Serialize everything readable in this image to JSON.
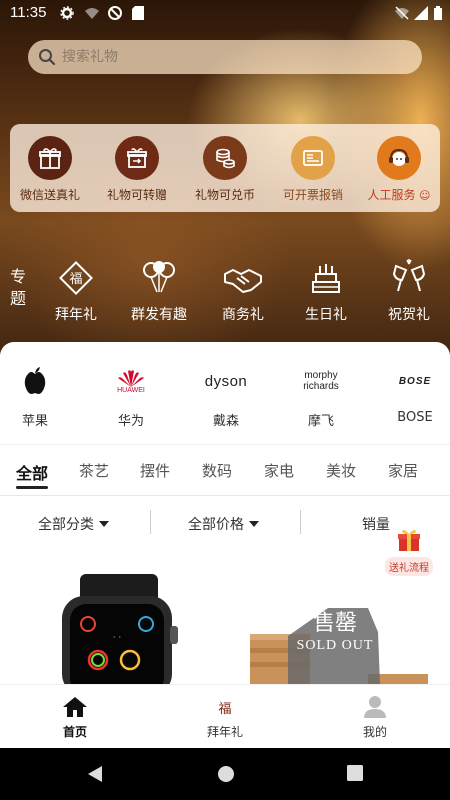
{
  "status_bar": {
    "time": "11:35"
  },
  "search": {
    "placeholder": "搜索礼物"
  },
  "services": [
    {
      "label": "微信送真礼",
      "icon": "gift-box-icon"
    },
    {
      "label": "礼物可转赠",
      "icon": "gift-transfer-icon"
    },
    {
      "label": "礼物可兑币",
      "icon": "coin-stack-icon"
    },
    {
      "label": "可开票报销",
      "icon": "invoice-icon"
    },
    {
      "label": "人工服务",
      "icon": "customer-service-icon"
    }
  ],
  "topics": {
    "title": "专题",
    "items": [
      {
        "label": "拜年礼",
        "icon": "fu-diamond-icon"
      },
      {
        "label": "群发有趣",
        "icon": "balloons-icon"
      },
      {
        "label": "商务礼",
        "icon": "handshake-icon"
      },
      {
        "label": "生日礼",
        "icon": "cake-icon"
      },
      {
        "label": "祝贺礼",
        "icon": "cheers-icon"
      }
    ]
  },
  "brands": [
    {
      "label": "苹果",
      "logo_text": ""
    },
    {
      "label": "华为",
      "logo_text": "HUAWEI"
    },
    {
      "label": "戴森",
      "logo_text": "dyson"
    },
    {
      "label": "摩飞",
      "logo_text": "morphy richards"
    },
    {
      "label": "BOSE",
      "logo_text": "BOSE"
    }
  ],
  "categories": [
    "全部",
    "茶艺",
    "摆件",
    "数码",
    "家电",
    "美妆",
    "家居"
  ],
  "filters": {
    "category": "全部分类",
    "price": "全部价格",
    "sales": "销量"
  },
  "gift_flow": {
    "label": "送礼流程"
  },
  "products": {
    "sold_out": {
      "title": "售罄",
      "subtitle": "SOLD OUT"
    }
  },
  "bottom_nav": [
    {
      "label": "首页",
      "icon": "home-icon",
      "active": true
    },
    {
      "label": "拜年礼",
      "icon": "fu-icon",
      "icon_text": "福",
      "active": false
    },
    {
      "label": "我的",
      "icon": "user-icon",
      "active": false
    }
  ],
  "colors": {
    "accent_brown": "#5a2c12",
    "service_circle": "#6b2a12",
    "huawei_red": "#cf0a2c",
    "gift_flow_red": "#c0392b"
  }
}
